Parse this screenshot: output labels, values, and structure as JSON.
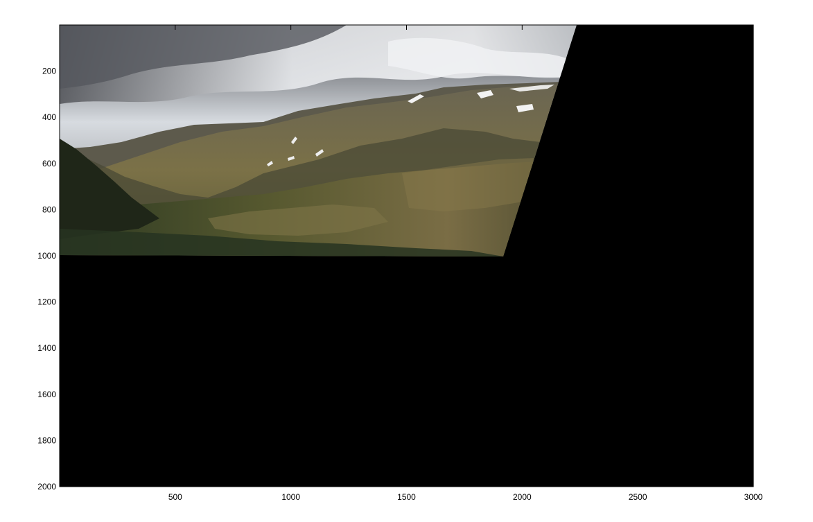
{
  "figure": {
    "background": "#ffffff",
    "axes_color": "#000000",
    "canvas_fill": "#000000"
  },
  "image": {
    "description_colors": {
      "sky_dark": "#4a4c52",
      "sky_light": "#d9dde2",
      "mountain_far": "#5a5a4e",
      "mountain_mid": "#6b6650",
      "hillside": "#7a6f48",
      "valley_green": "#3e4a2a",
      "forest_dark": "#232a1c",
      "snow": "#f2f2f2"
    },
    "x_range": [
      0,
      3000
    ],
    "y_range": [
      0,
      2000
    ],
    "y_reversed": true
  },
  "axes": {
    "x_ticks": [
      "500",
      "1000",
      "1500",
      "2000",
      "2500",
      "3000"
    ],
    "y_ticks": [
      "200",
      "400",
      "600",
      "800",
      "1000",
      "1200",
      "1400",
      "1600",
      "1800",
      "2000"
    ]
  }
}
